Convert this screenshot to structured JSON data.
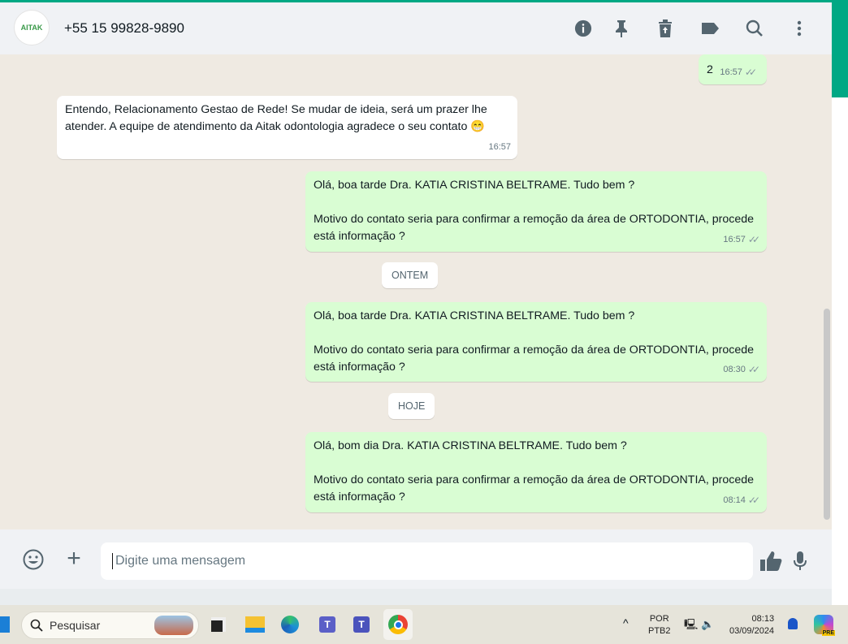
{
  "header": {
    "contact": "+55 15 99828-9890",
    "avatar_text": "AITAK",
    "icons": [
      "info-icon",
      "pin-icon",
      "delete-icon",
      "label-icon",
      "search-icon",
      "menu-icon"
    ]
  },
  "messages": [
    {
      "dir": "out",
      "text": "2",
      "time": "16:57"
    },
    {
      "dir": "in",
      "text": "Entendo, Relacionamento Gestao de Rede! Se mudar de ideia, será um prazer lhe atender. A equipe de atendimento da Aitak odontologia agradece o seu contato 😁",
      "time": "16:57"
    },
    {
      "dir": "out",
      "line1": "Olá, boa tarde Dra.  KATIA CRISTINA BELTRAME. Tudo bem ?",
      "line2": "Motivo do contato seria para confirmar a remoção da área de ORTODONTIA, procede está informação ?",
      "time": "16:57"
    },
    {
      "chip": "ONTEM"
    },
    {
      "dir": "out",
      "line1": "Olá, boa tarde Dra.  KATIA CRISTINA BELTRAME. Tudo bem ?",
      "line2": "Motivo do contato seria para confirmar a remoção da área de ORTODONTIA, procede está informação ?",
      "time": "08:30"
    },
    {
      "chip": "HOJE"
    },
    {
      "dir": "out",
      "line1": "Olá, bom dia Dra.  KATIA CRISTINA BELTRAME. Tudo bem ?",
      "line2": "Motivo do contato seria para confirmar a remoção da área de ORTODONTIA, procede está informação ?",
      "time": "08:14"
    }
  ],
  "composer": {
    "placeholder": "Digite uma mensagem"
  },
  "taskbar": {
    "search": "Pesquisar",
    "lang1": "POR",
    "lang2": "PTB2",
    "time": "08:13",
    "date": "03/09/2024",
    "copilot_badge": "PRE"
  },
  "ticks": "✓✓"
}
